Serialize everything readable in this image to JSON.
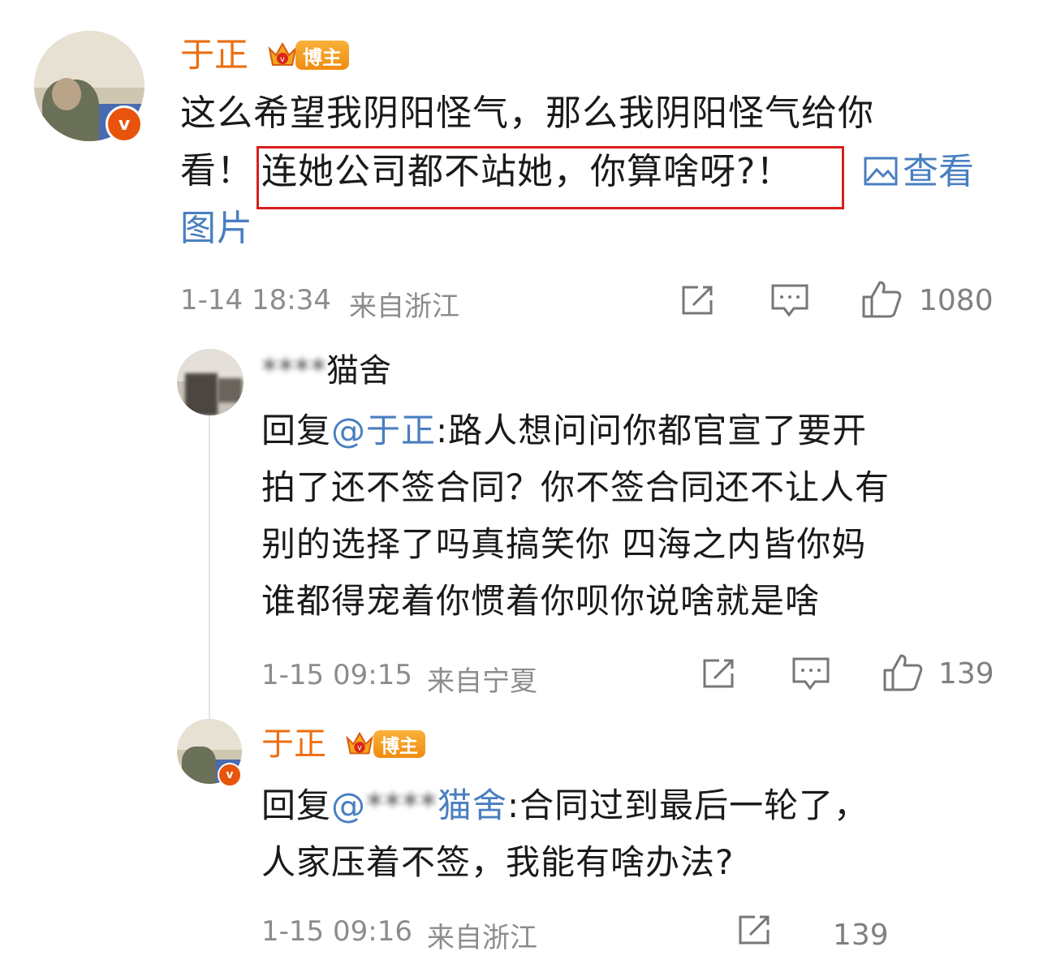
{
  "post": {
    "username": "于正",
    "badge": "博主",
    "verified_mark": "v",
    "content_line1": "这么希望我阴阳怪气，那么我阴阳怪气给你",
    "content_line2_prefix": "看！",
    "content_highlight": "连她公司都不站她，你算啥呀?！",
    "view_image_icon": "image-icon",
    "view_image_text_1": "查看",
    "view_image_text_2": "图片",
    "timestamp": "1-14 18:34",
    "location": "来自浙江",
    "like_count": "1080"
  },
  "reply1": {
    "username_blurred": "****",
    "username_visible": "猫舍",
    "reply_prefix": "回复",
    "mention": "@于正",
    "colon_text": ":路人想问问你都官宣了要开",
    "line2": "拍了还不签合同？你不签合同还不让人有",
    "line3": "别的选择了吗真搞笑你 四海之内皆你妈",
    "line4": "谁都得宠着你惯着你呗你说啥就是啥",
    "timestamp": "1-15 09:15",
    "location": "来自宁夏",
    "like_count": "139"
  },
  "reply2": {
    "username": "于正",
    "badge": "博主",
    "verified_mark": "v",
    "reply_prefix": "回复",
    "mention_at": "@",
    "mention_blurred": "****",
    "mention_visible": "猫舍",
    "colon_text": ":合同过到最后一轮了，",
    "line2": "人家压着不签，我能有啥办法?",
    "timestamp": "1-15 09:16",
    "location": "来自浙江",
    "like_count": "139"
  },
  "colors": {
    "username": "#eb6f12",
    "link": "#4a7fc0",
    "highlight_border": "#d81e1e",
    "meta": "#8c8c8c",
    "verified": "#e8540b"
  }
}
